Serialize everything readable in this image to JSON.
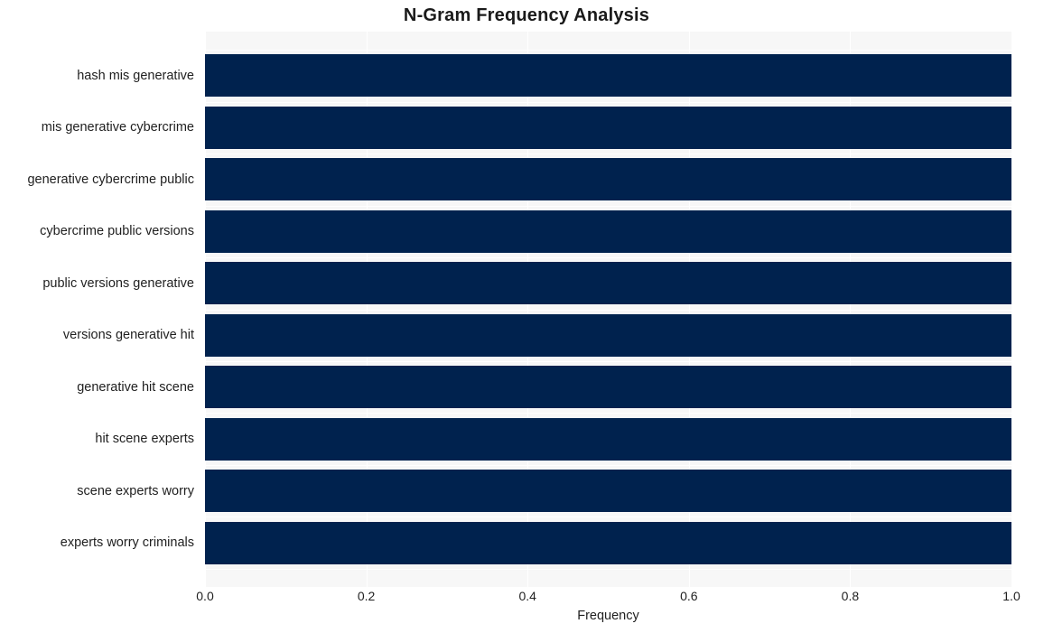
{
  "chart_data": {
    "type": "bar",
    "orientation": "horizontal",
    "title": "N-Gram Frequency Analysis",
    "xlabel": "Frequency",
    "ylabel": "",
    "xlim": [
      0.0,
      1.0
    ],
    "xticks": [
      0.0,
      0.2,
      0.4,
      0.6,
      0.8,
      1.0
    ],
    "xtick_labels": [
      "0.0",
      "0.2",
      "0.4",
      "0.6",
      "0.8",
      "1.0"
    ],
    "grid": "vertical-white-on-gray",
    "legend": null,
    "bar_color": "#00224e",
    "plot_background": "#f7f7f7",
    "categories": [
      "hash mis generative",
      "mis generative cybercrime",
      "generative cybercrime public",
      "cybercrime public versions",
      "public versions generative",
      "versions generative hit",
      "generative hit scene",
      "hit scene experts",
      "scene experts worry",
      "experts worry criminals"
    ],
    "values": [
      1.0,
      1.0,
      1.0,
      1.0,
      1.0,
      1.0,
      1.0,
      1.0,
      1.0,
      1.0
    ]
  }
}
